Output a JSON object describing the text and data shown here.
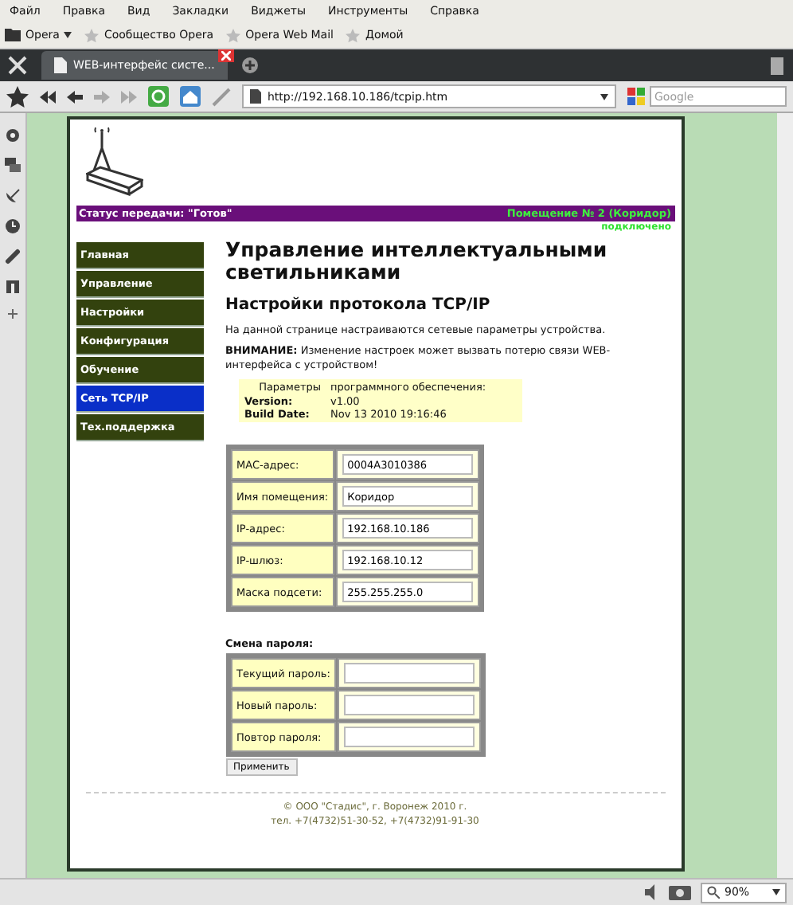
{
  "menu": [
    "Файл",
    "Правка",
    "Вид",
    "Закладки",
    "Виджеты",
    "Инструменты",
    "Справка"
  ],
  "bookmarks": [
    {
      "kind": "folder",
      "label": "Opera",
      "dropdown": true
    },
    {
      "kind": "star",
      "label": "Сообщество Opera",
      "dropdown": false
    },
    {
      "kind": "star",
      "label": "Opera Web Mail",
      "dropdown": false
    },
    {
      "kind": "star",
      "label": "Домой",
      "dropdown": false
    }
  ],
  "tabs": [
    {
      "label": "WEB-интерфейс систе...",
      "selected": true
    }
  ],
  "address": {
    "url": "http://192.168.10.186/tcpip.htm"
  },
  "search": {
    "placeholder": "Google"
  },
  "page": {
    "status": "Статус передачи: \"Готов\"",
    "room": "Помещение № 2 (Коридор)",
    "connection": "подключено",
    "nav": [
      {
        "label": "Главная",
        "selected": false
      },
      {
        "label": "Управление",
        "selected": false
      },
      {
        "label": "Настройки",
        "selected": false
      },
      {
        "label": "Конфигурация",
        "selected": false
      },
      {
        "label": "Обучение",
        "selected": false
      },
      {
        "label": "Сеть TCP/IP",
        "selected": true
      },
      {
        "label": "Тех.поддержка",
        "selected": false
      }
    ],
    "title": "Управление интеллектуальными светильниками",
    "subtitle": "Настройки протокола TCP/IP",
    "intro": "На данной странице настраиваются сетевые параметры устройства.",
    "warning": "**ВНИМАНИЕ:** Изменение настроек может вызвать потерю связи WEB-интерфейса с устройством!",
    "firmware": {
      "caption_1": "Параметры",
      "caption_2": "программного обеспечения:",
      "rows": [
        {
          "label": "Version:",
          "value": "v1.00"
        },
        {
          "label": "Build Date:",
          "value": "Nov 13 2010 19:16:46"
        }
      ]
    },
    "network_fields": [
      {
        "label": "MAC-адрес:",
        "value": "0004A3010386"
      },
      {
        "label": "Имя помещения:",
        "value": "Коридор"
      },
      {
        "label": "IP-адрес:",
        "value": "192.168.10.186"
      },
      {
        "label": "IP-шлюз:",
        "value": "192.168.10.12"
      },
      {
        "label": "Маска подсети:",
        "value": "255.255.255.0"
      }
    ],
    "password": {
      "heading": "Смена пароля:",
      "fields": [
        {
          "label": "Текущий пароль:"
        },
        {
          "label": "Новый пароль:"
        },
        {
          "label": "Повтор пароля:"
        }
      ],
      "button": "Применить"
    },
    "footer": [
      "© ООО \"Стадис\", г. Воронеж 2010 г.",
      "тел. +7(4732)51-30-52, +7(4732)91-91-30"
    ]
  },
  "status_bar": {
    "zoom": "90%"
  }
}
